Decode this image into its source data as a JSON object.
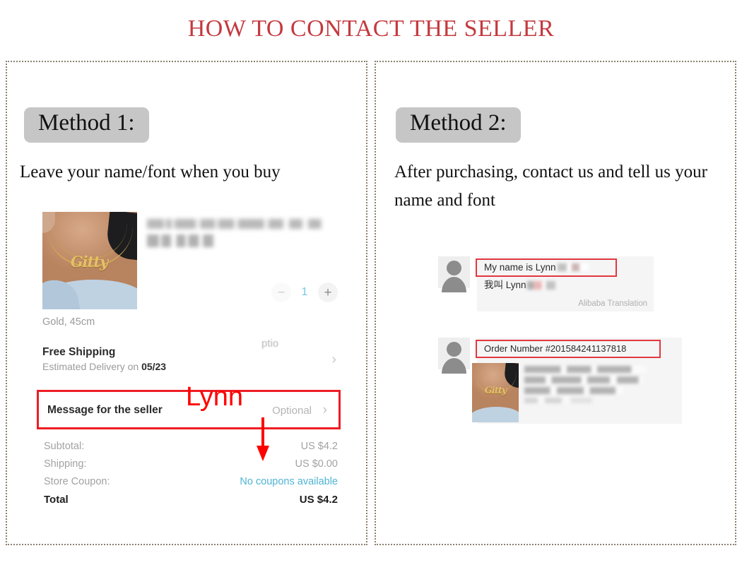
{
  "title": "HOW TO CONTACT THE SELLER",
  "accent_color": "#c43a3f",
  "panels": {
    "left": {
      "badge": "Method 1:",
      "description": "Leave your name/font when you buy",
      "order_screenshot": {
        "product_title_blurred": "Personalized Name Necklace, Cu...",
        "product_price_blurred": "US $4.2",
        "pendant_name": "Gitty",
        "quantity": {
          "minus_label": "−",
          "value": "1",
          "plus_label": "+",
          "value_color": "#77c6e0"
        },
        "variant": "Gold, 45cm",
        "shipping_title": "Free Shipping",
        "shipping_estimate_prefix": "Estimated Delivery on ",
        "shipping_estimate_date": "05/23",
        "optional_ghost": "ptio",
        "message_row": {
          "label": "Message for the seller",
          "value": "Optional",
          "chevron": "›",
          "highlight_color": "#ee1c25"
        },
        "totals": [
          {
            "label": "Subtotal:",
            "value": "US $4.2",
            "style": "muted"
          },
          {
            "label": "Shipping:",
            "value": "US $0.00",
            "style": "muted"
          },
          {
            "label": "Store Coupon:",
            "value": "No coupons available",
            "style": "coupon"
          },
          {
            "label": "Total",
            "value": "US $4.2",
            "style": "grand"
          }
        ]
      },
      "annotation": {
        "text": "Lynn",
        "color": "#ff0000",
        "arrow": "down-arrow"
      }
    },
    "right": {
      "badge": "Method 2:",
      "description": "After purchasing, contact us and tell us your name and font",
      "chat_screenshot": {
        "messages": [
          {
            "english": "My name is Lynn",
            "chinese": "我叫 Lynn",
            "translation_note": "Alibaba Translation",
            "highlighted": true
          },
          {
            "order_number": "Order Number #201584241137818",
            "highlighted": true,
            "product_card": {
              "pendant_name": "Gitty",
              "title_blurred": "Personalized Old English Fo... Name Necklace, G Pen..."
            }
          }
        ],
        "highlight_color": "#e2383f"
      }
    }
  }
}
